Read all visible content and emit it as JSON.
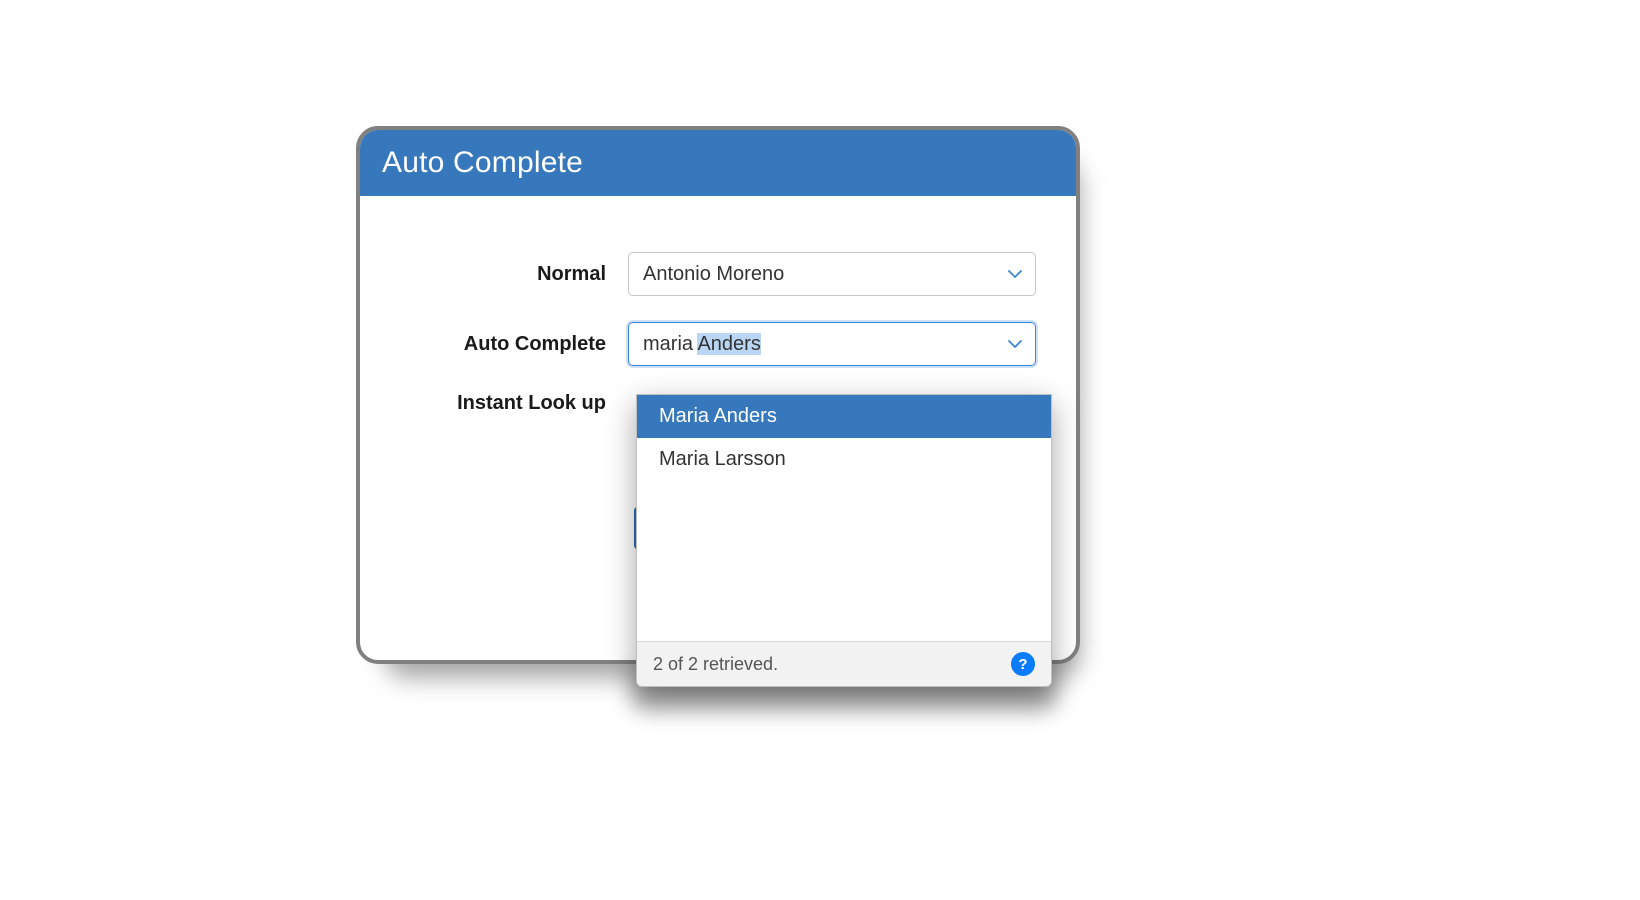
{
  "header": {
    "title": "Auto Complete"
  },
  "labels": {
    "normal": "Normal",
    "autocomplete": "Auto Complete",
    "instant": "Instant Look up"
  },
  "fields": {
    "normal_value": "Antonio Moreno",
    "autocomplete_typed": "maria ",
    "autocomplete_suffix": "Anders"
  },
  "dropdown": {
    "options": [
      "Maria Anders",
      "Maria Larsson"
    ],
    "highlighted_index": 0,
    "status_text": "2 of 2 retrieved.",
    "help_glyph": "?"
  },
  "colors": {
    "brand": "#3778bc",
    "focus": "#3d86d6",
    "selection_bg": "#b9d7f4",
    "help_bg": "#0a7cff"
  }
}
